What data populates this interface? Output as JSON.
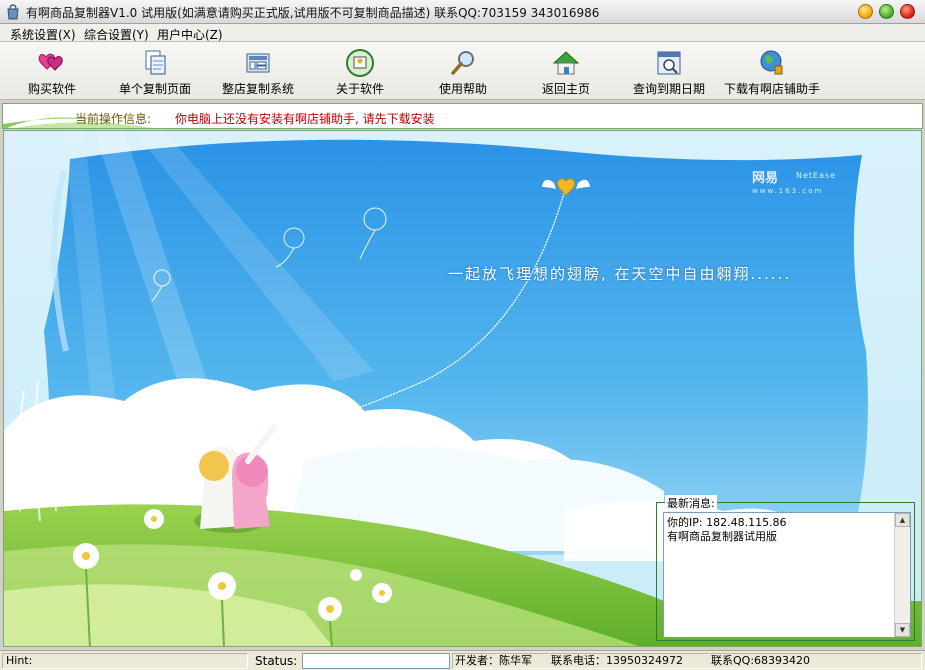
{
  "window": {
    "title": "有啊商品复制器V1.0  试用版(如满意请购买正式版,试用版不可复制商品描述)  联系QQ:703159  343016986"
  },
  "menu": [
    {
      "label": "系统设置(X)"
    },
    {
      "label": "综合设置(Y)"
    },
    {
      "label": "用户中心(Z)"
    }
  ],
  "toolbar": [
    {
      "label": "购买软件",
      "icon": "hearts-icon"
    },
    {
      "label": "单个复制页面",
      "icon": "document-copy-icon"
    },
    {
      "label": "整店复制系统",
      "icon": "store-copy-icon"
    },
    {
      "label": "关于软件",
      "icon": "about-icon"
    },
    {
      "label": "使用帮助",
      "icon": "magnifier-icon"
    },
    {
      "label": "返回主页",
      "icon": "home-icon"
    },
    {
      "label": "查询到期日期",
      "icon": "calendar-search-icon"
    },
    {
      "label": "下载有啊店铺助手",
      "icon": "globe-download-icon"
    }
  ],
  "info": {
    "label": "当前操作信息:",
    "message": "你电脑上还没有安装有啊店铺助手, 请先下载安装"
  },
  "scene": {
    "slogan": "一起放飞理想的翅膀, 在天空中自由翱翔......",
    "brand_cn": "网易",
    "brand_en": "NetEase",
    "brand_url": "www.163.com"
  },
  "news": {
    "title": "最新消息:",
    "lines": [
      "你的IP: 182.48.115.86",
      "有啊商品复制器试用版"
    ]
  },
  "status": {
    "hint_label": "Hint:",
    "status_label": "Status:",
    "developer": "开发者：陈华军",
    "phone": "联系电话：13950324972",
    "qq": "联系QQ:68393420"
  },
  "colors": {
    "sky": "#3aa0e8",
    "grass": "#7cc23a",
    "info_text": "#c00000",
    "panel_border": "#2e7d2e"
  }
}
